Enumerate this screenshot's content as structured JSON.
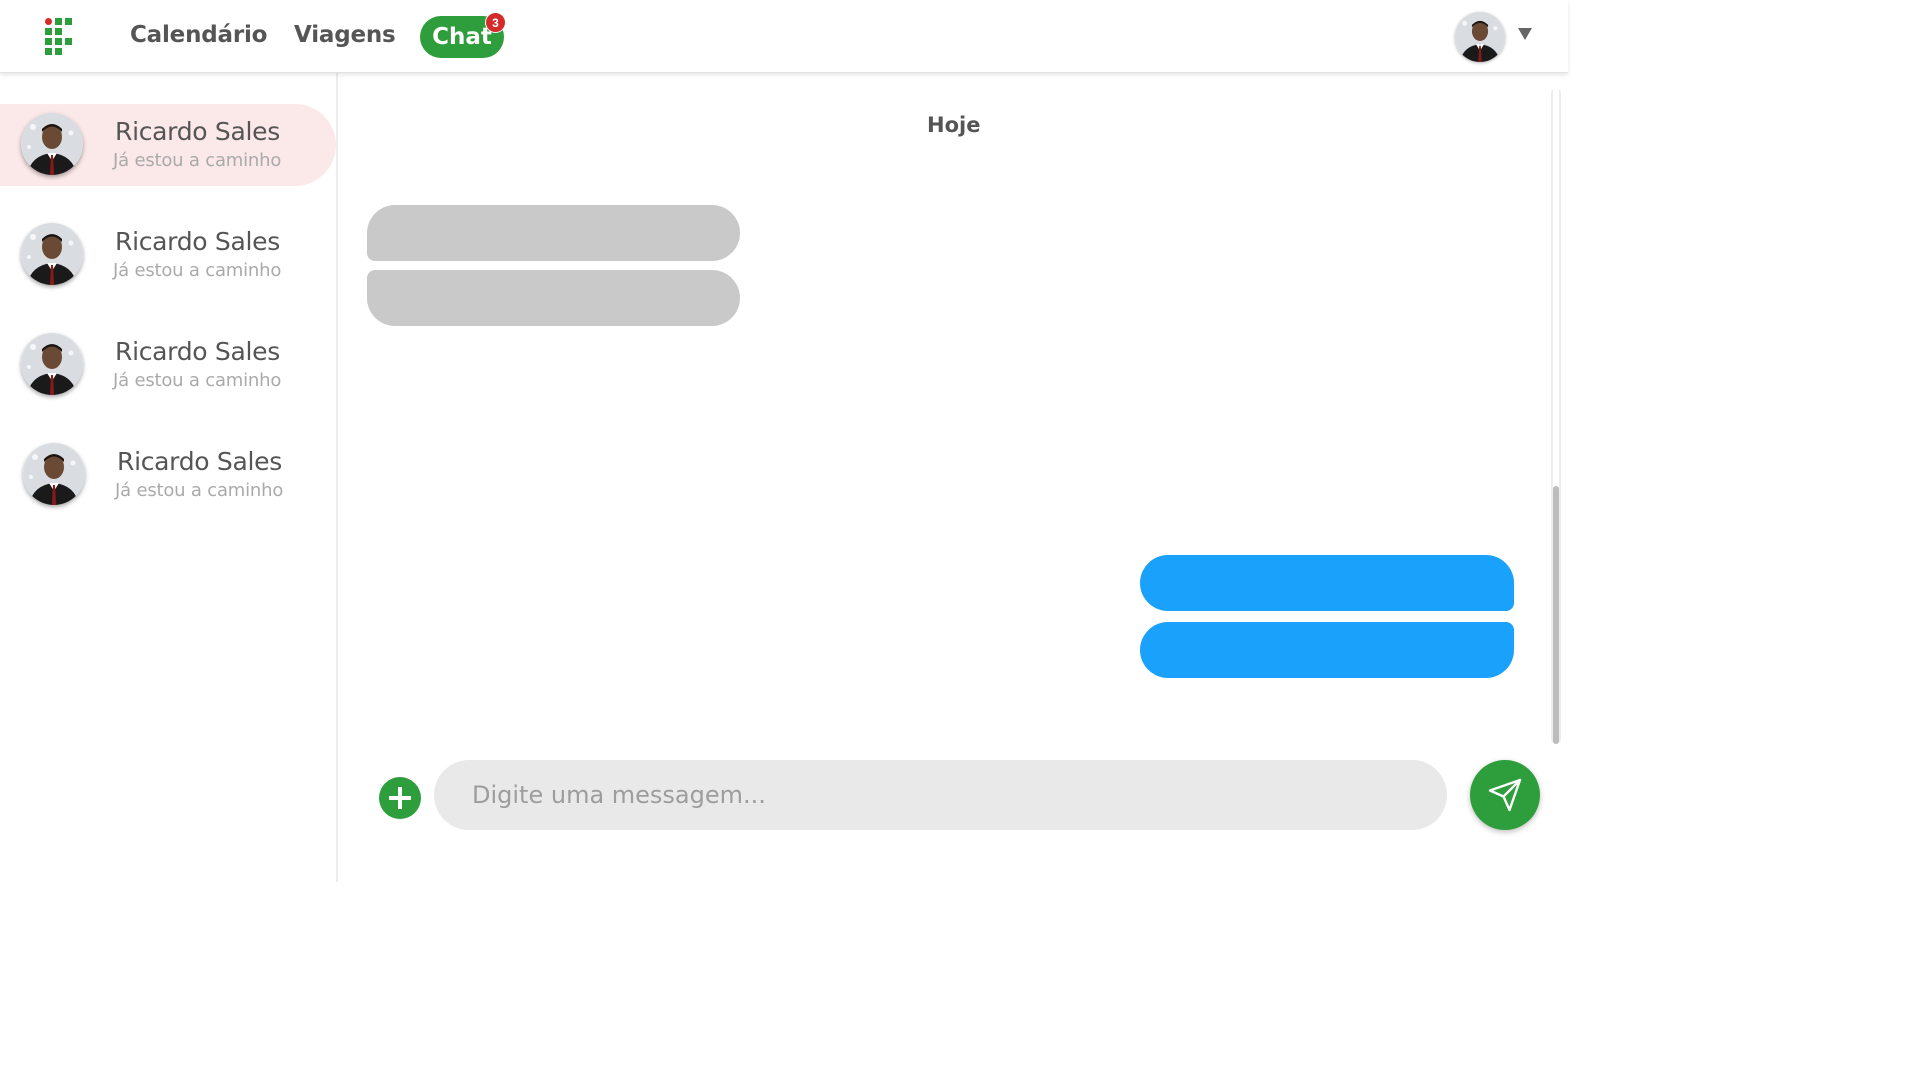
{
  "nav": {
    "links": [
      {
        "label": "Calendário"
      },
      {
        "label": "Viagens"
      }
    ],
    "active": {
      "label": "Chat",
      "badge": "3"
    }
  },
  "contacts": [
    {
      "name": "Ricardo Sales",
      "last_message": "Já estou a caminho",
      "active": true
    },
    {
      "name": "Ricardo Sales",
      "last_message": "Já estou a caminho",
      "active": false
    },
    {
      "name": "Ricardo Sales",
      "last_message": "Já estou a caminho",
      "active": false
    },
    {
      "name": "Ricardo Sales",
      "last_message": "Já estou a caminho",
      "active": false
    }
  ],
  "conversation": {
    "day_label": "Hoje"
  },
  "composer": {
    "placeholder": "Digite uma messagem..."
  },
  "colors": {
    "brand_green": "#2e9d3b",
    "badge_red": "#d42a2a",
    "outgoing_bubble": "#1aa1fb",
    "incoming_bubble": "#c9c9c9",
    "active_contact_bg": "#fbe8e8"
  },
  "icons": {
    "logo": "institution-logo-icon",
    "add": "plus-icon",
    "send": "paper-plane-icon",
    "menu": "caret-down-icon"
  }
}
